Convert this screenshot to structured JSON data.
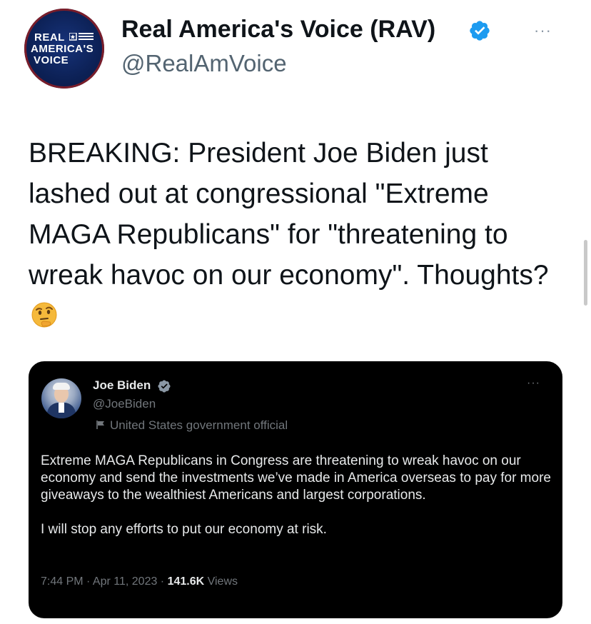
{
  "header": {
    "avatar_lines": [
      "REAL",
      "AMERICA'S",
      "VOICE"
    ],
    "display_name": "Real America's Voice (RAV)",
    "handle": "@RealAmVoice",
    "more": "···"
  },
  "tweet": {
    "text": "BREAKING: President Joe Biden just lashed out at congressional \"Extreme MAGA Republicans\" for \"threatening to wreak havoc on our economy\". Thoughts?",
    "emoji": "thinking-face"
  },
  "quote": {
    "name": "Joe Biden",
    "handle": "@JoeBiden",
    "affiliation": "United States government official",
    "more": "···",
    "paragraphs": [
      "Extreme MAGA Republicans in Congress are threatening to wreak havoc on our economy and send the investments we’ve made in America overseas to pay for more giveaways to the wealthiest Americans and largest corporations.",
      "I will stop any efforts to put our economy at risk."
    ],
    "time": "7:44 PM · Apr 11, 2023 · ",
    "views_count": "141.6K",
    "views_label": " Views"
  },
  "colors": {
    "verified": "#1d9bf0",
    "secondary_text": "#536471",
    "quote_bg": "#000000"
  }
}
